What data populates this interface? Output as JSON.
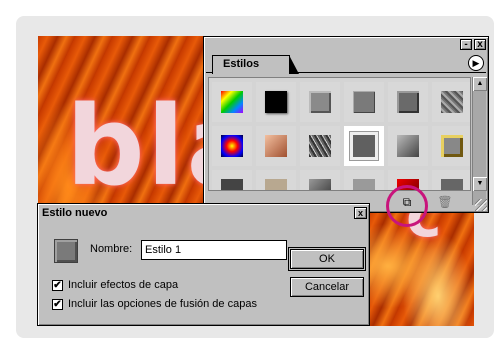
{
  "styles_palette": {
    "tab_label": "Estilos",
    "titlebar_min": "-",
    "titlebar_close": "x",
    "menu_glyph": "▶",
    "scroll_up": "▲",
    "scroll_down": "▼",
    "footer_new": "⧉",
    "footer_delete": "🗑"
  },
  "dialog": {
    "title": "Estilo nuevo",
    "close_glyph": "x",
    "name_label": "Nombre:",
    "name_value": "Estilo 1",
    "option_effects": "Incluir efectos de capa",
    "option_effects_checked": true,
    "option_blending": "Incluir las opciones de fusión de capas",
    "option_blending_checked": true,
    "check_glyph": "✔",
    "ok_label": "OK",
    "cancel_label": "Cancelar"
  },
  "photo": {
    "text_large": "bla",
    "text_small": "c"
  },
  "colors": {
    "highlight": "#c8147c",
    "fire": "#e85a08"
  }
}
